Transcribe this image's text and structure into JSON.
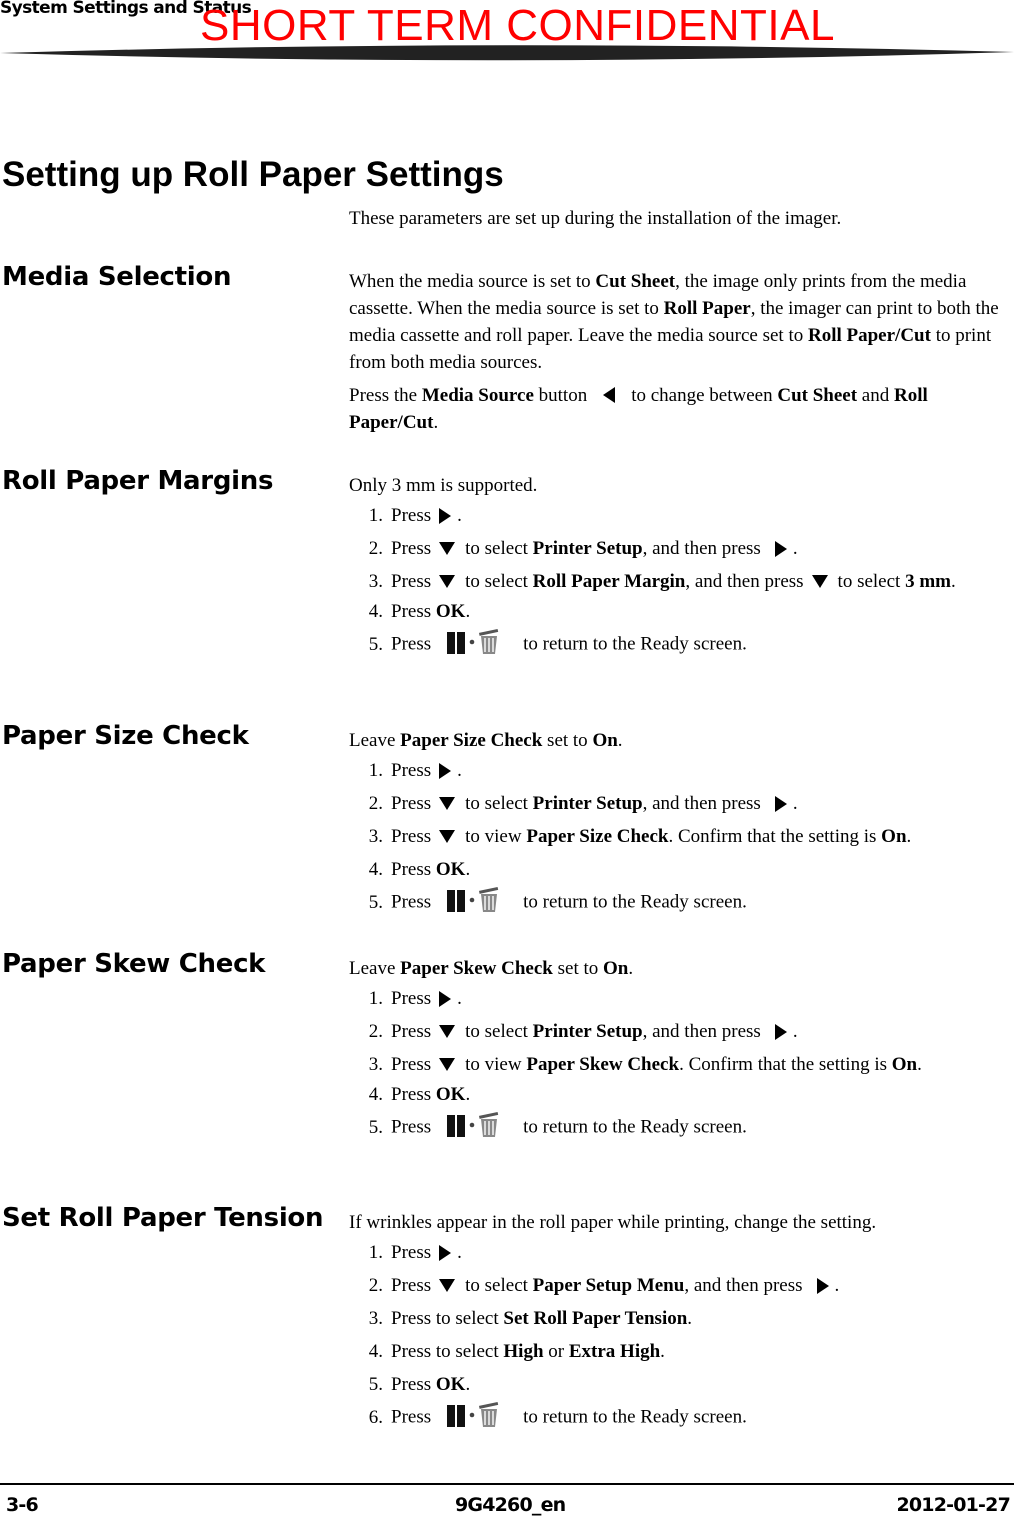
{
  "header": {
    "section_title": "System Settings and Status",
    "watermark": "SHORT TERM CONFIDENTIAL"
  },
  "page_title": "Setting up Roll Paper Settings",
  "intro": "These parameters are set up during the installation of the imager.",
  "icons": {
    "right": "right-arrow-icon",
    "down": "down-arrow-icon",
    "left": "left-arrow-icon",
    "cancel": "pause-trash-icon"
  },
  "sections": {
    "media": {
      "heading": "Media Selection",
      "p1": {
        "a": "When the media source is set to ",
        "b1": "Cut Sheet",
        "c": ", the image only prints from the media cassette. When the media source is set to ",
        "b2": "Roll Paper",
        "d": ", the imager can print to both the media cassette and roll paper. Leave the media source set to ",
        "b3": "Roll Paper/Cut",
        "e": " to print from both media sources."
      },
      "p2": {
        "a": "Press the ",
        "b1": "Media Source",
        "c": " button",
        "d": "to change between ",
        "b2": "Cut Sheet",
        "e": " and ",
        "b3": "Roll Paper/Cut",
        "f": "."
      }
    },
    "margins": {
      "heading": "Roll Paper Margins",
      "intro": "Only 3 mm is supported.",
      "steps": [
        {
          "num": "1.",
          "press": "Press",
          "end": "."
        },
        {
          "num": "2.",
          "press": "Press",
          "mid": "to select ",
          "bold": "Printer Setup",
          "after": ", and then press",
          "end": "."
        },
        {
          "num": "3.",
          "press": "Press",
          "mid": "to select ",
          "bold": "Roll Paper Margin",
          "after": ", and then press",
          "after2": "to select ",
          "bold2": "3 mm",
          "end": "."
        },
        {
          "num": "4.",
          "press": "Press ",
          "bold": "OK",
          "end": "."
        },
        {
          "num": "5.",
          "press": "Press",
          "after": "to return to the Ready screen."
        }
      ]
    },
    "size": {
      "heading": "Paper Size Check",
      "intro_a": "Leave ",
      "intro_b": "Paper Size Check",
      "intro_c": " set to ",
      "intro_d": "On",
      "intro_e": ".",
      "steps": [
        {
          "num": "1.",
          "press": "Press",
          "end": "."
        },
        {
          "num": "2.",
          "press": "Press",
          "mid": "to select ",
          "bold": "Printer Setup",
          "after": ", and then press",
          "end": "."
        },
        {
          "num": "3.",
          "press": "Press",
          "mid": "to view ",
          "bold": "Paper Size Check",
          "after": ". Confirm that the setting is ",
          "bold2": "On",
          "end": "."
        },
        {
          "num": "4.",
          "press": "Press ",
          "bold": "OK",
          "end": "."
        },
        {
          "num": "5.",
          "press": "Press",
          "after": "to return to the Ready screen."
        }
      ]
    },
    "skew": {
      "heading": "Paper Skew Check",
      "intro_a": "Leave ",
      "intro_b": "Paper Skew Check",
      "intro_c": " set to ",
      "intro_d": "On",
      "intro_e": ".",
      "steps": [
        {
          "num": "1.",
          "press": "Press",
          "end": "."
        },
        {
          "num": "2.",
          "press": "Press",
          "mid": "to select ",
          "bold": "Printer Setup",
          "after": ", and then press",
          "end": "."
        },
        {
          "num": "3.",
          "press": "Press",
          "mid": "to view ",
          "bold": "Paper Skew Check",
          "after": ". Confirm that the setting is ",
          "bold2": "On",
          "end": "."
        },
        {
          "num": "4.",
          "press": "Press ",
          "bold": "OK",
          "end": "."
        },
        {
          "num": "5.",
          "press": "Press",
          "after": "to return to the Ready screen."
        }
      ]
    },
    "tension": {
      "heading": "Set Roll Paper Tension",
      "intro": "If wrinkles appear in the roll paper while printing, change the setting.",
      "steps": [
        {
          "num": "1.",
          "press": "Press",
          "end": "."
        },
        {
          "num": "2.",
          "press": "Press",
          "mid": "to select ",
          "bold": "Paper Setup Menu",
          "after": ", and then press",
          "end": "."
        },
        {
          "num": "3.",
          "press": "Press to select ",
          "bold": "Set Roll Paper Tension",
          "end": "."
        },
        {
          "num": "4.",
          "press": "Press to select ",
          "bold": "High",
          "mid": " or ",
          "bold2": "Extra High",
          "end": "."
        },
        {
          "num": "5.",
          "press": "Press ",
          "bold": "OK",
          "end": "."
        },
        {
          "num": "6.",
          "press": "Press",
          "after": "to return to the Ready screen."
        }
      ]
    }
  },
  "footer": {
    "page": "3-6",
    "doc_id": "9G4260_en",
    "date": "2012-01-27"
  }
}
